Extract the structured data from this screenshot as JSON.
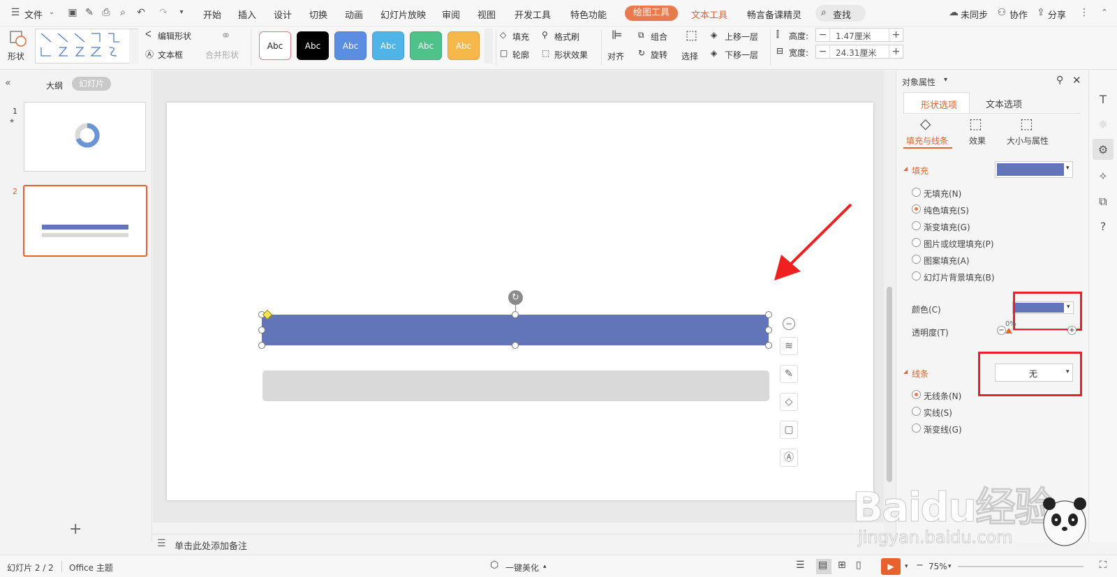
{
  "menubar": {
    "file_label": "文件",
    "tabs": [
      "开始",
      "插入",
      "设计",
      "切换",
      "动画",
      "幻灯片放映",
      "审阅",
      "视图",
      "开发工具",
      "特色功能"
    ],
    "drawing_tools": "绘图工具",
    "text_tools": "文本工具",
    "lesson_elf": "畅言备课精灵",
    "search": "查找",
    "unsynced": "未同步",
    "collab": "协作",
    "share": "分享"
  },
  "ribbon": {
    "shape_label": "形状",
    "edit_shape": "编辑形状",
    "textbox": "文本框",
    "merge_shape": "合并形状",
    "style_boxes": [
      {
        "label": "Abc",
        "bg": "#ffffff",
        "fg": "#222222",
        "border": "#e07a8a"
      },
      {
        "label": "Abc",
        "bg": "#000000",
        "fg": "#ffffff",
        "border": "#000000"
      },
      {
        "label": "Abc",
        "bg": "#5b8ee0",
        "fg": "#ffffff",
        "border": "#4a7ccc"
      },
      {
        "label": "Abc",
        "bg": "#4fb4e8",
        "fg": "#ffffff",
        "border": "#3ea0d4"
      },
      {
        "label": "Abc",
        "bg": "#4fc28a",
        "fg": "#ffffff",
        "border": "#3aa876"
      },
      {
        "label": "Abc",
        "bg": "#f7b84a",
        "fg": "#ffffff",
        "border": "#e6a233"
      }
    ],
    "fill": "填充",
    "format_brush": "格式刷",
    "outline": "轮廓",
    "shape_effect": "形状效果",
    "align": "对齐",
    "group": "组合",
    "rotate": "旋转",
    "select": "选择",
    "bring_forward": "上移一层",
    "send_backward": "下移一层",
    "height_label": "高度:",
    "height_value": "1.47厘米",
    "width_label": "宽度:",
    "width_value": "24.31厘米"
  },
  "leftpanel": {
    "outline_tab": "大纲",
    "slides_tab": "幻灯片",
    "slides": [
      {
        "num": "1"
      },
      {
        "num": "2"
      }
    ],
    "add": "+"
  },
  "canvas": {
    "selected_bar_color": "#6275b8",
    "gray_bar_color": "#d9d9d9"
  },
  "notes": {
    "placeholder": "单击此处添加备注"
  },
  "rightpanel": {
    "title": "对象属性",
    "tab_shape": "形状选项",
    "tab_text": "文本选项",
    "sub_fill_line": "填充与线条",
    "sub_effect": "效果",
    "sub_size": "大小与属性",
    "fill_section": "填充",
    "fill_color": "#6275b8",
    "fill_options": [
      "无填充(N)",
      "纯色填充(S)",
      "渐变填充(G)",
      "图片或纹理填充(P)",
      "图案填充(A)",
      "幻灯片背景填充(B)"
    ],
    "color_label": "颜色(C)",
    "transparency_label": "透明度(T)",
    "transparency_value": "0%",
    "line_section": "线条",
    "line_value": "无",
    "line_options": [
      "无线条(N)",
      "实线(S)",
      "渐变线(G)"
    ]
  },
  "statusbar": {
    "slide_info": "幻灯片 2 / 2",
    "theme": "Office 主题",
    "beautify": "一键美化",
    "zoom": "75%"
  },
  "watermark": {
    "text": "Baidu经验",
    "url": "jingyan.baidu.com"
  }
}
